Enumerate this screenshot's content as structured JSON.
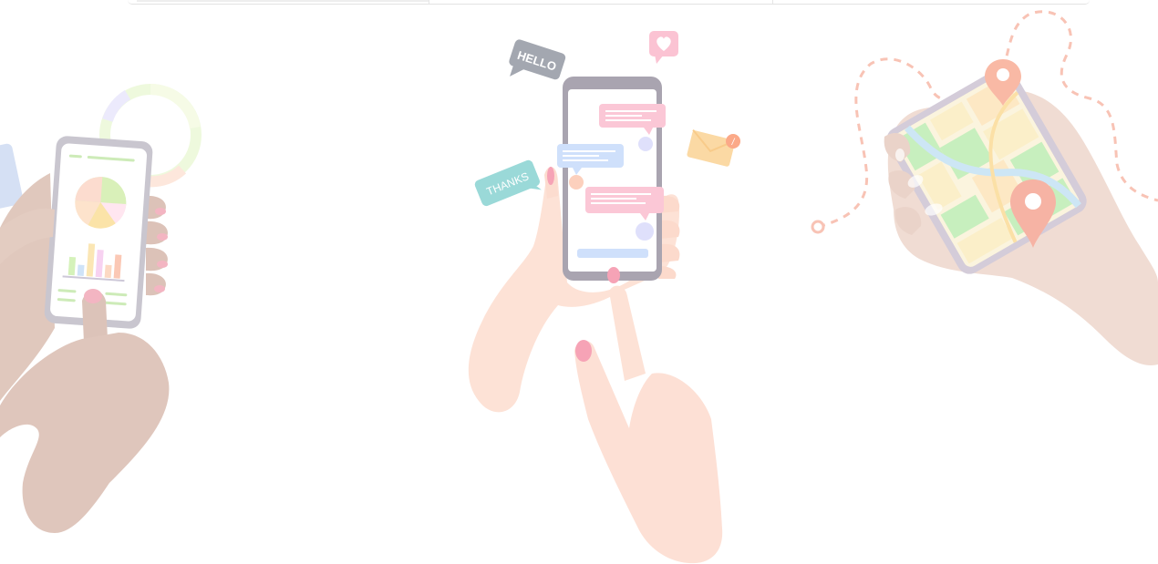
{
  "bubbles": {
    "hello": "HELLO",
    "thanks": "THANKS"
  },
  "colors": {
    "skin_dark": "#e0c7bd",
    "skin_light": "#fde0d4",
    "nail": "#f6a3b6",
    "phone_frame_gray": "#a9a4b0",
    "bubble_pink": "#fbc7d6",
    "bubble_blue": "#cfe0fb",
    "bubble_teal": "#9ad9d8",
    "bubble_gray": "#9ea2ab",
    "map_green": "#c7efbe",
    "map_yellow": "#fbefc9",
    "pin": "#f6b3a4",
    "route_dash": "#f8c3b5"
  },
  "icons": [
    "heart-icon",
    "envelope-icon",
    "alert-icon",
    "location-pin-icon",
    "pie-chart-icon",
    "bar-chart-icon"
  ]
}
